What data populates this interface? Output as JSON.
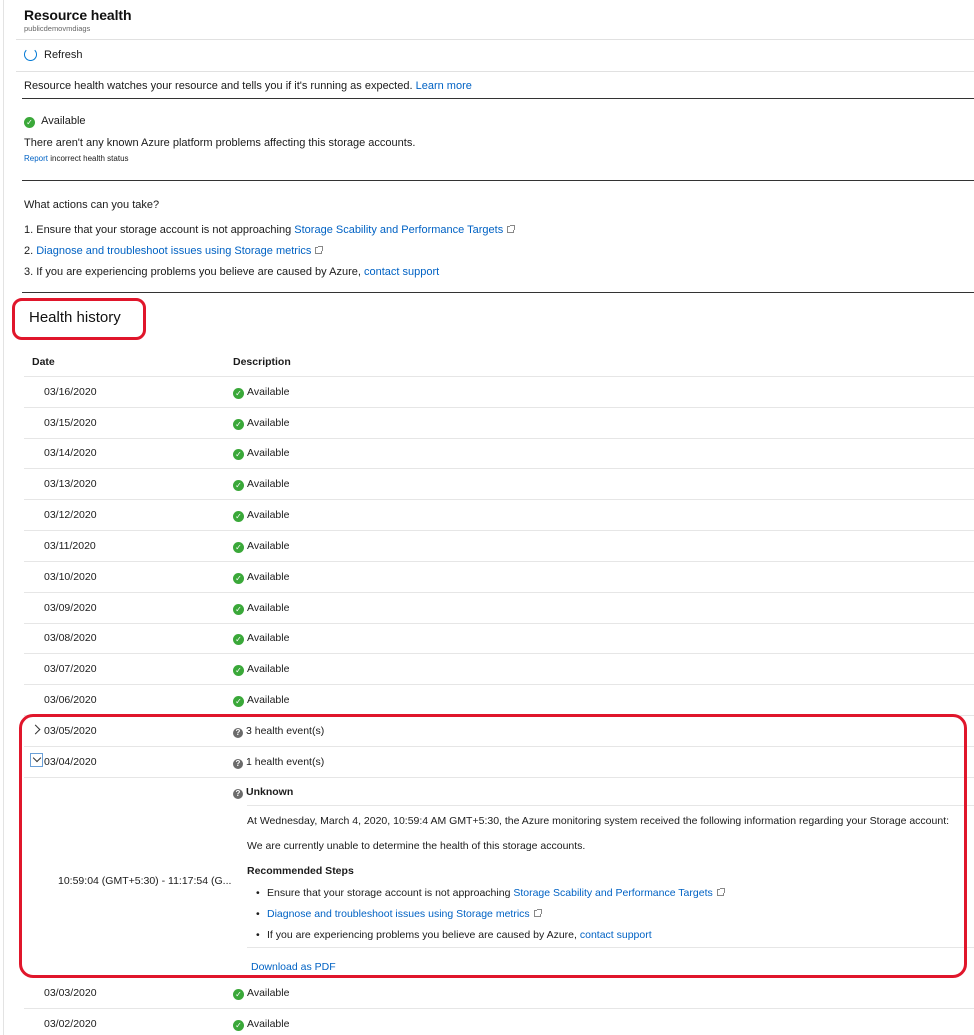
{
  "header": {
    "title": "Resource health",
    "subtitle": "publicdemovmdiags"
  },
  "toolbar": {
    "refresh_label": "Refresh"
  },
  "intro": {
    "text": "Resource health watches your resource and tells you if it's running as expected.",
    "link": "Learn more"
  },
  "status": {
    "title": "Available",
    "description": "There aren't any known Azure platform problems affecting this storage accounts.",
    "report_link": "Report",
    "report_text": "incorrect health status"
  },
  "actions": {
    "title": "What actions can you take?",
    "items": [
      {
        "prefix": "1.  Ensure that your storage account is not approaching ",
        "link": "Storage Scability and Performance Targets"
      },
      {
        "prefix": "2.  ",
        "link": "Diagnose and troubleshoot issues using Storage metrics"
      },
      {
        "prefix": "3.  If you are experiencing problems you believe are caused by Azure, ",
        "link": "contact support"
      }
    ]
  },
  "history": {
    "title": "Health history",
    "columns": {
      "date": "Date",
      "description": "Description"
    },
    "rows": [
      {
        "date": "03/16/2020",
        "description": "Available"
      },
      {
        "date": "03/15/2020",
        "description": "Available"
      },
      {
        "date": "03/14/2020",
        "description": "Available"
      },
      {
        "date": "03/13/2020",
        "description": "Available"
      },
      {
        "date": "03/12/2020",
        "description": "Available"
      },
      {
        "date": "03/11/2020",
        "description": "Available"
      },
      {
        "date": "03/10/2020",
        "description": "Available"
      },
      {
        "date": "03/09/2020",
        "description": "Available"
      },
      {
        "date": "03/08/2020",
        "description": "Available"
      },
      {
        "date": "03/07/2020",
        "description": "Available"
      },
      {
        "date": "03/06/2020",
        "description": "Available"
      },
      {
        "date": "03/05/2020",
        "description": "3 health event(s)"
      },
      {
        "date": "03/04/2020",
        "description": "1 health event(s)"
      },
      {
        "date": "03/03/2020",
        "description": "Available"
      },
      {
        "date": "03/02/2020",
        "description": "Available"
      }
    ],
    "event_detail": {
      "time_range": "10:59:04 (GMT+5:30) - 11:17:54 (G...",
      "status": "Unknown",
      "message": "At Wednesday, March 4, 2020, 10:59:4 AM GMT+5:30, the Azure monitoring system received the following information regarding your Storage account:",
      "summary": "We are currently unable to determine the health of this storage accounts.",
      "steps_title": "Recommended Steps",
      "steps": [
        {
          "prefix": "Ensure that your storage account is not approaching ",
          "link": "Storage Scability and Performance Targets"
        },
        {
          "prefix": "",
          "link": "Diagnose and troubleshoot issues using Storage metrics"
        },
        {
          "prefix": "If you are experiencing problems you believe are caused by Azure, ",
          "link": "contact support"
        }
      ],
      "download_label": "Download as PDF"
    }
  },
  "colors": {
    "accent": "#0062c4",
    "available": "#3aa839",
    "highlight": "#e0162b"
  },
  "icons": [
    "refresh-icon",
    "check-circle-icon",
    "question-circle-icon",
    "external-link-icon",
    "chevron-right-icon",
    "chevron-down-icon"
  ]
}
